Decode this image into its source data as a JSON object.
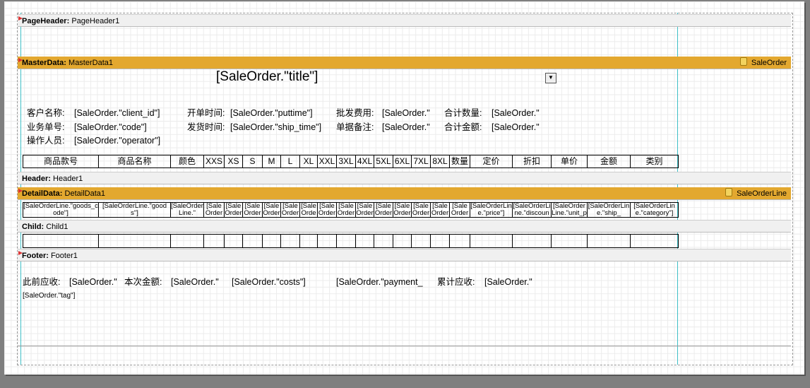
{
  "bands": {
    "page_header": {
      "type": "PageHeader:",
      "name": "PageHeader1"
    },
    "master_data": {
      "type": "MasterData:",
      "name": "MasterData1",
      "datasource": "SaleOrder"
    },
    "header": {
      "type": "Header:",
      "name": "Header1"
    },
    "detail_data": {
      "type": "DetailData:",
      "name": "DetailData1",
      "datasource": "SaleOrderLine"
    },
    "child": {
      "type": "Child:",
      "name": "Child1"
    },
    "footer": {
      "type": "Footer:",
      "name": "Footer1"
    }
  },
  "master": {
    "title": "[SaleOrder.\"title\"]",
    "client_label": "客户名称:",
    "client_value": "[SaleOrder.\"client_id\"]",
    "code_label": "业务单号:",
    "code_value": "[SaleOrder.\"code\"]",
    "operator_label": "操作人员:",
    "operator_value": "[SaleOrder.\"operator\"]",
    "puttime_label": "开单时间:",
    "puttime_value": "[SaleOrder.\"puttime\"]",
    "shiptime_label": "发货时间:",
    "shiptime_value": "[SaleOrder.\"ship_time\"]",
    "fee_label": "批发费用:",
    "fee_value": "[SaleOrder.\"",
    "remark_label": "单据备注:",
    "remark_value": "[SaleOrder.\"",
    "qty_label": "合计数量:",
    "qty_value": "[SaleOrder.\"",
    "amount_label": "合计金额:",
    "amount_value": "[SaleOrder.\""
  },
  "columns": [
    "商品款号",
    "商品名称",
    "颜色",
    "XXS",
    "XS",
    "S",
    "M",
    "L",
    "XL",
    "XXL",
    "3XL",
    "4XL",
    "5XL",
    "6XL",
    "7XL",
    "8XL",
    "数量",
    "定价",
    "折扣",
    "单价",
    "金额",
    "类别"
  ],
  "detail_cells": [
    "[SaleOrderLine.\"goods_code\"]",
    "[SaleOrderLine.\"goods\"]",
    "[SaleOrderLine.\"",
    "[SaleOrderLine.\"",
    "[SaleOrderLine.\"",
    "[SaleOrderLine.\"",
    "[SaleOrderLine.\"",
    "[SaleOrderLine.\"",
    "[SaleOrderLine.\"",
    "[SaleOrderLine.\"",
    "[SaleOrderLine.\"",
    "[SaleOrderLine.\"",
    "[SaleOrderLine.\"",
    "[SaleOrderLine.\"",
    "[SaleOrderLine.\"",
    "[SaleOrderLine.\"",
    "[SaleOrderLine.\"ship",
    "[SaleOrderLine.\"price\"]",
    "[SaleOrderLine.\"discoun",
    "[SaleOrderLine.\"unit_p",
    "[SaleOrderLine.\"ship_",
    "[SaleOrderLine.\"category\"]"
  ],
  "footer": {
    "prev_label": "此前应收:",
    "prev_value": "[SaleOrder.\"",
    "current_label": "本次金额:",
    "current_value": "[SaleOrder.\"",
    "costs_value": "[SaleOrder.\"costs\"]",
    "payment_value": "[SaleOrder.\"payment_",
    "total_label": "累计应收:",
    "total_value": "[SaleOrder.\"",
    "tag_value": "[SaleOrder.\"tag\"]"
  }
}
